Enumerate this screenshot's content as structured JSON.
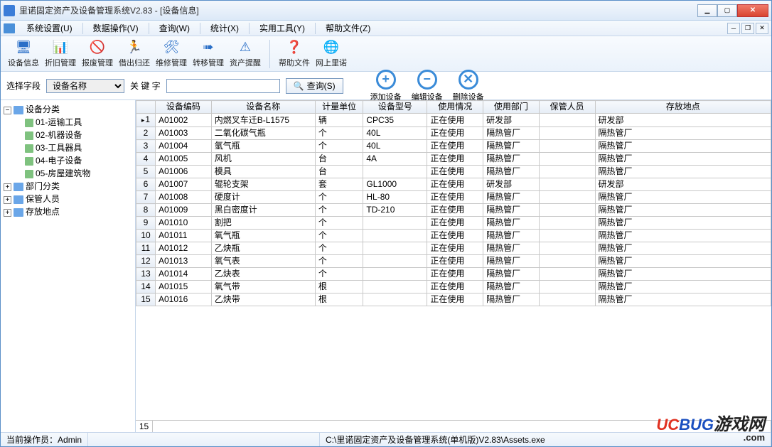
{
  "titlebar": {
    "title": "里诺固定资产及设备管理系统V2.83 - [设备信息]"
  },
  "menubar": {
    "items": [
      "系统设置(U)",
      "数据操作(V)",
      "查询(W)",
      "统计(X)",
      "实用工具(Y)",
      "帮助文件(Z)"
    ]
  },
  "toolbar": {
    "items": [
      {
        "label": "设备信息",
        "glyph": "🖥"
      },
      {
        "label": "折旧管理",
        "glyph": "📊"
      },
      {
        "label": "报废管理",
        "glyph": "🚫"
      },
      {
        "label": "借出归还",
        "glyph": "🏃"
      },
      {
        "label": "维修管理",
        "glyph": "🛠"
      },
      {
        "label": "转移管理",
        "glyph": "➠"
      },
      {
        "label": "资产提醒",
        "glyph": "⚠"
      }
    ],
    "items2": [
      {
        "label": "帮助文件",
        "glyph": "❓"
      },
      {
        "label": "网上里诺",
        "glyph": "🌐"
      }
    ]
  },
  "search": {
    "field_label": "选择字段",
    "field_value": "设备名称",
    "key_label": "关 键 字",
    "key_value": "",
    "query_btn": "查询(S)"
  },
  "roundbtns": {
    "add": "添加设备",
    "edit": "编辑设备",
    "del": "删除设备"
  },
  "tree": {
    "root1": {
      "label": "设备分类",
      "expanded": true,
      "children": [
        "01-运输工具",
        "02-机器设备",
        "03-工具器具",
        "04-电子设备",
        "05-房屋建筑物"
      ]
    },
    "root2": {
      "label": "部门分类"
    },
    "root3": {
      "label": "保管人员"
    },
    "root4": {
      "label": "存放地点"
    }
  },
  "grid": {
    "columns": [
      "设备编码",
      "设备名称",
      "计量单位",
      "设备型号",
      "使用情况",
      "使用部门",
      "保管人员",
      "存放地点"
    ],
    "rows": [
      [
        "A01002",
        "内燃叉车迁B-L1575",
        "辆",
        "CPC35",
        "正在使用",
        "研发部",
        "",
        "研发部"
      ],
      [
        "A01003",
        "二氧化碳气瓶",
        "个",
        "40L",
        "正在使用",
        "隔热管厂",
        "",
        "隔热管厂"
      ],
      [
        "A01004",
        "氩气瓶",
        "个",
        "40L",
        "正在使用",
        "隔热管厂",
        "",
        "隔热管厂"
      ],
      [
        "A01005",
        "风机",
        "台",
        "4A",
        "正在使用",
        "隔热管厂",
        "",
        "隔热管厂"
      ],
      [
        "A01006",
        "模具",
        "台",
        "",
        "正在使用",
        "隔热管厂",
        "",
        "隔热管厂"
      ],
      [
        "A01007",
        "辊轮支架",
        "套",
        "GL1000",
        "正在使用",
        "研发部",
        "",
        "研发部"
      ],
      [
        "A01008",
        "硬度计",
        "个",
        "HL-80",
        "正在使用",
        "隔热管厂",
        "",
        "隔热管厂"
      ],
      [
        "A01009",
        "黑白密度计",
        "个",
        "TD-210",
        "正在使用",
        "隔热管厂",
        "",
        "隔热管厂"
      ],
      [
        "A01010",
        "割把",
        "个",
        "",
        "正在使用",
        "隔热管厂",
        "",
        "隔热管厂"
      ],
      [
        "A01011",
        "氧气瓶",
        "个",
        "",
        "正在使用",
        "隔热管厂",
        "",
        "隔热管厂"
      ],
      [
        "A01012",
        "乙炔瓶",
        "个",
        "",
        "正在使用",
        "隔热管厂",
        "",
        "隔热管厂"
      ],
      [
        "A01013",
        "氧气表",
        "个",
        "",
        "正在使用",
        "隔热管厂",
        "",
        "隔热管厂"
      ],
      [
        "A01014",
        "乙炔表",
        "个",
        "",
        "正在使用",
        "隔热管厂",
        "",
        "隔热管厂"
      ],
      [
        "A01015",
        "氧气带",
        "根",
        "",
        "正在使用",
        "隔热管厂",
        "",
        "隔热管厂"
      ],
      [
        "A01016",
        "乙炔带",
        "根",
        "",
        "正在使用",
        "隔热管厂",
        "",
        "隔热管厂"
      ]
    ],
    "footer_count": "15"
  },
  "statusbar": {
    "operator_label": "当前操作员：",
    "operator": "Admin",
    "path": "C:\\里诺固定资产及设备管理系统(单机版)V2.83\\Assets.exe"
  },
  "watermark": {
    "brand1": "UC",
    "brand2": "BUG",
    "brand3": "游戏网",
    "suffix": ".com"
  }
}
